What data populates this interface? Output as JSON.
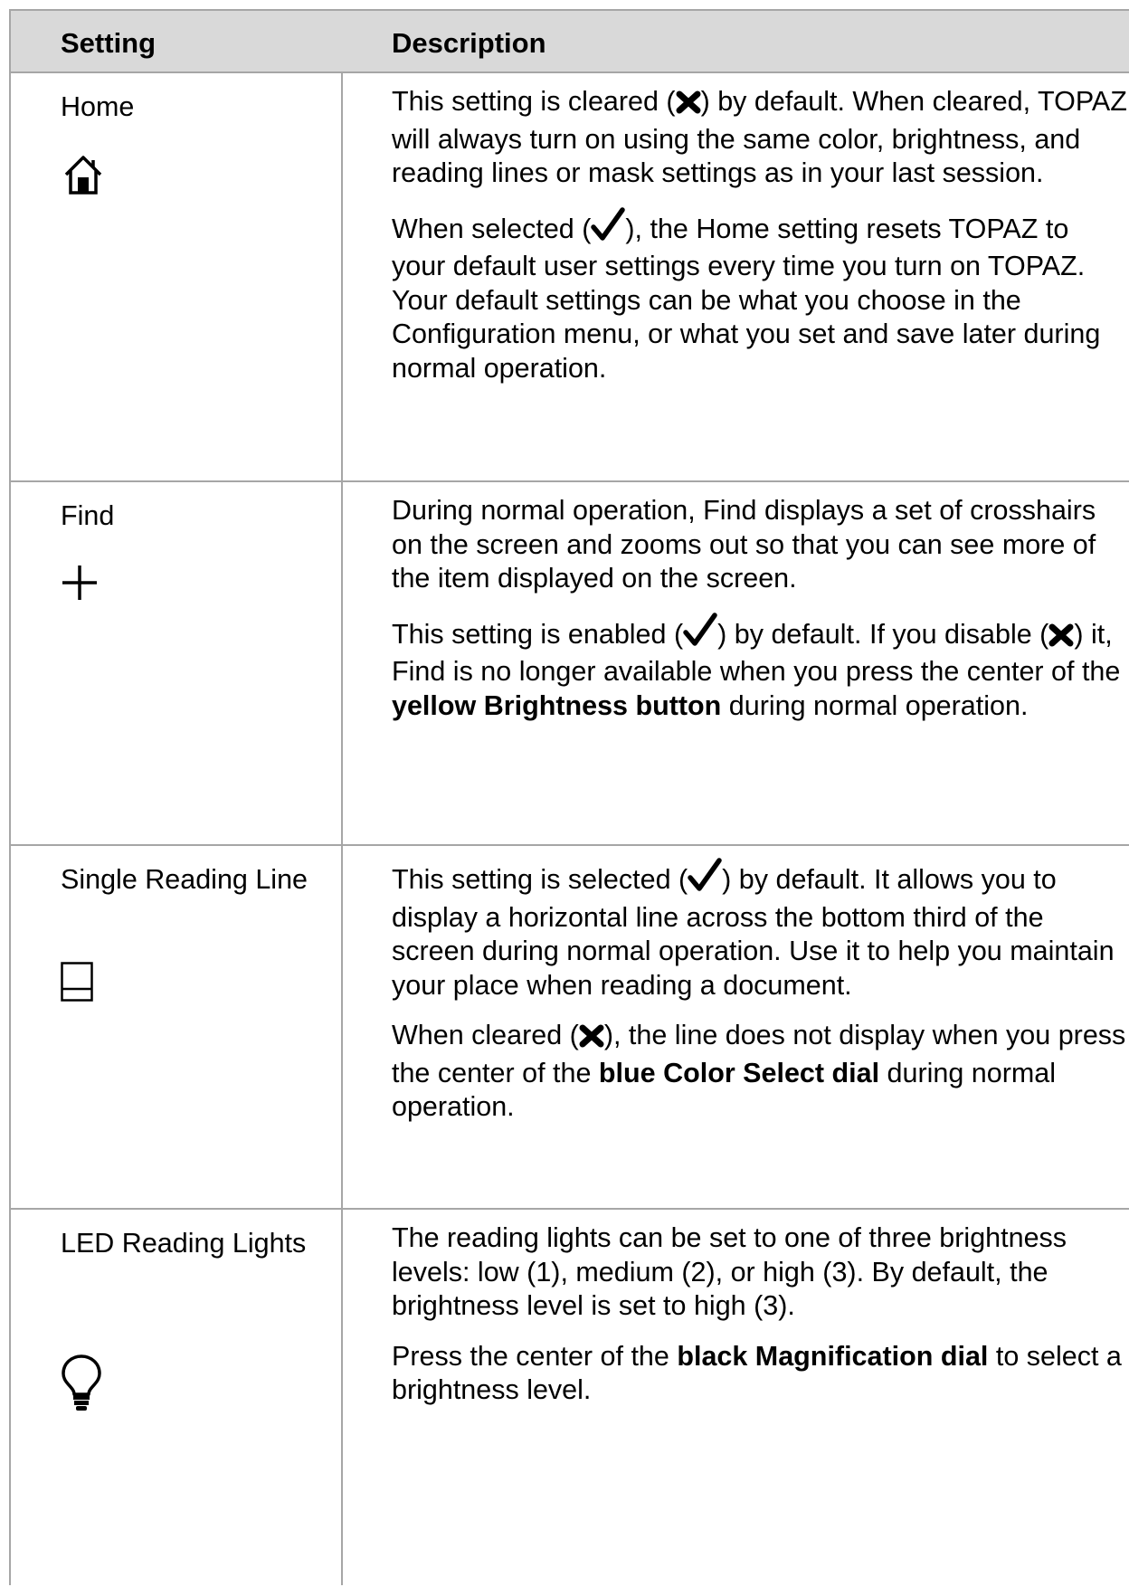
{
  "header": {
    "setting": "Setting",
    "description": "Description"
  },
  "rows": [
    {
      "name": "Home",
      "icon": "home-icon",
      "p1": {
        "a": "This setting is cleared (",
        "b": ") by default. When cleared, TOPAZ will always turn on using the same color, brightness, and reading lines or mask settings as in your last session."
      },
      "p2": {
        "a": "When selected (",
        "b": "), the Home setting resets TOPAZ to your default user settings every time you turn on TOPAZ. Your default settings can be what you choose in the Configuration menu, or what you set and save later during normal operation."
      }
    },
    {
      "name": "Find",
      "icon": "crosshair-plus-icon",
      "p1": {
        "text": "During normal operation, Find displays a set of crosshairs on the screen and zooms out so that you can see more of the item displayed on the screen."
      },
      "p2": {
        "a": "This setting is enabled (",
        "b": ") by default. If you disable (",
        "c": ") it, Find is no longer available when you press the center of the ",
        "bold1": "yellow Brightness button",
        "d": " during normal operation."
      }
    },
    {
      "name": "Single Reading Line",
      "icon": "reading-line-icon",
      "p1": {
        "a": "This setting is selected (",
        "b": ") by default. It allows you to display a horizontal line across the bottom third of the screen during normal operation. Use it to help you maintain your place when reading a document."
      },
      "p2": {
        "a": "When cleared (",
        "b": "), the line does not display when you press the center of the ",
        "bold1": "blue Color Select dial",
        "c": " during normal operation."
      }
    },
    {
      "name": "LED Reading Lights",
      "icon": "lightbulb-icon",
      "p1": {
        "text": "The reading lights can be set to one of three brightness levels: low (1), medium (2), or high (3). By default, the brightness level is set to high (3)."
      },
      "p2": {
        "a": "Press the center of the ",
        "bold1": "black Magnification dial",
        "b": " to select a brightness level."
      }
    }
  ]
}
